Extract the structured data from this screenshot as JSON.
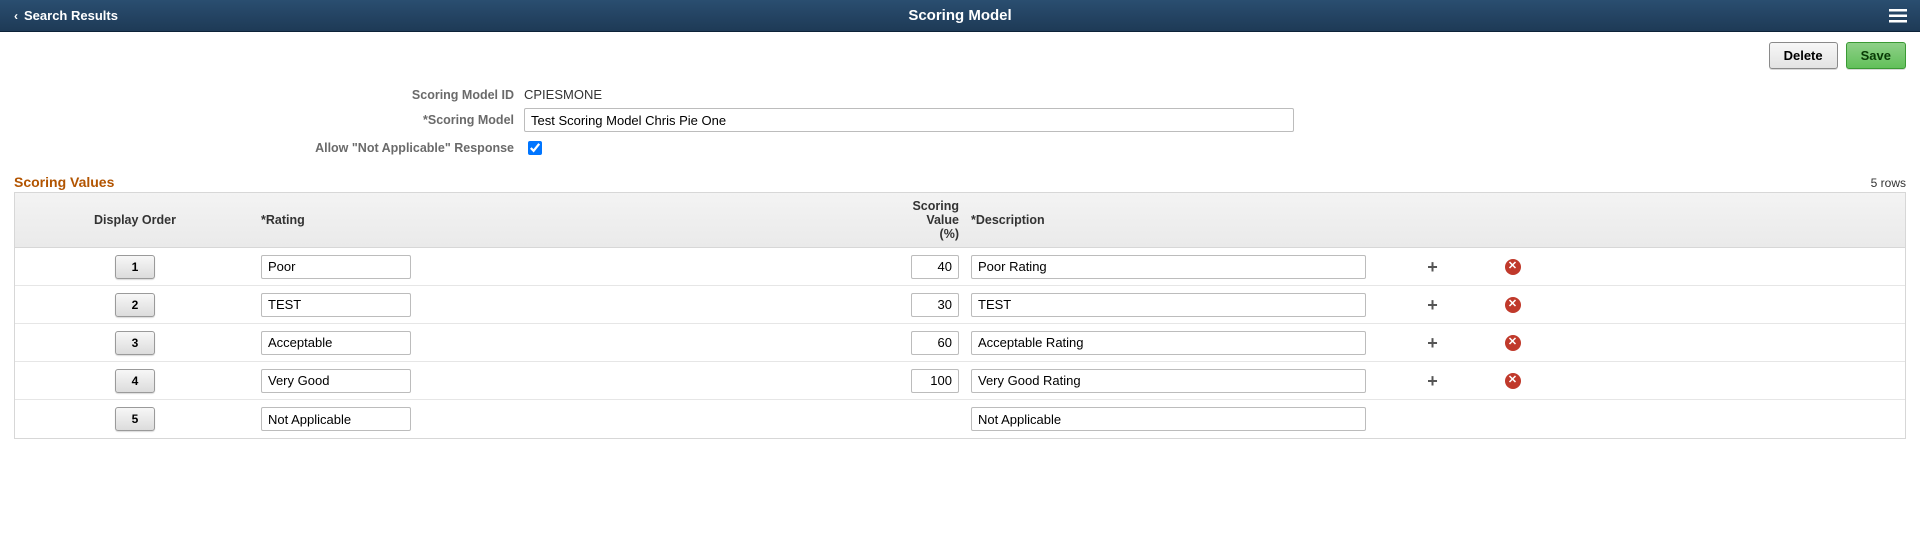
{
  "header": {
    "back_label": "Search Results",
    "title": "Scoring Model"
  },
  "actions": {
    "delete": "Delete",
    "save": "Save"
  },
  "form": {
    "id_label": "Scoring Model ID",
    "id_value": "CPIESMONE",
    "name_label": "*Scoring Model",
    "name_value": "Test Scoring Model Chris Pie One",
    "allow_na_label": "Allow \"Not Applicable\" Response",
    "allow_na_checked": true
  },
  "grid": {
    "section_title": "Scoring Values",
    "row_count_label": "5 rows",
    "headers": {
      "order": "Display Order",
      "rating": "*Rating",
      "score": "Scoring Value (%)",
      "description": "*Description"
    },
    "rows": [
      {
        "order": "1",
        "rating": "Poor",
        "score": "40",
        "description": "Poor Rating",
        "show_score": true,
        "show_add": true,
        "show_del": true
      },
      {
        "order": "2",
        "rating": "TEST",
        "score": "30",
        "description": "TEST",
        "show_score": true,
        "show_add": true,
        "show_del": true
      },
      {
        "order": "3",
        "rating": "Acceptable",
        "score": "60",
        "description": "Acceptable Rating",
        "show_score": true,
        "show_add": true,
        "show_del": true
      },
      {
        "order": "4",
        "rating": "Very Good",
        "score": "100",
        "description": "Very Good Rating",
        "show_score": true,
        "show_add": true,
        "show_del": true
      },
      {
        "order": "5",
        "rating": "Not Applicable",
        "score": "",
        "description": "Not Applicable",
        "show_score": false,
        "show_add": false,
        "show_del": false
      }
    ]
  }
}
